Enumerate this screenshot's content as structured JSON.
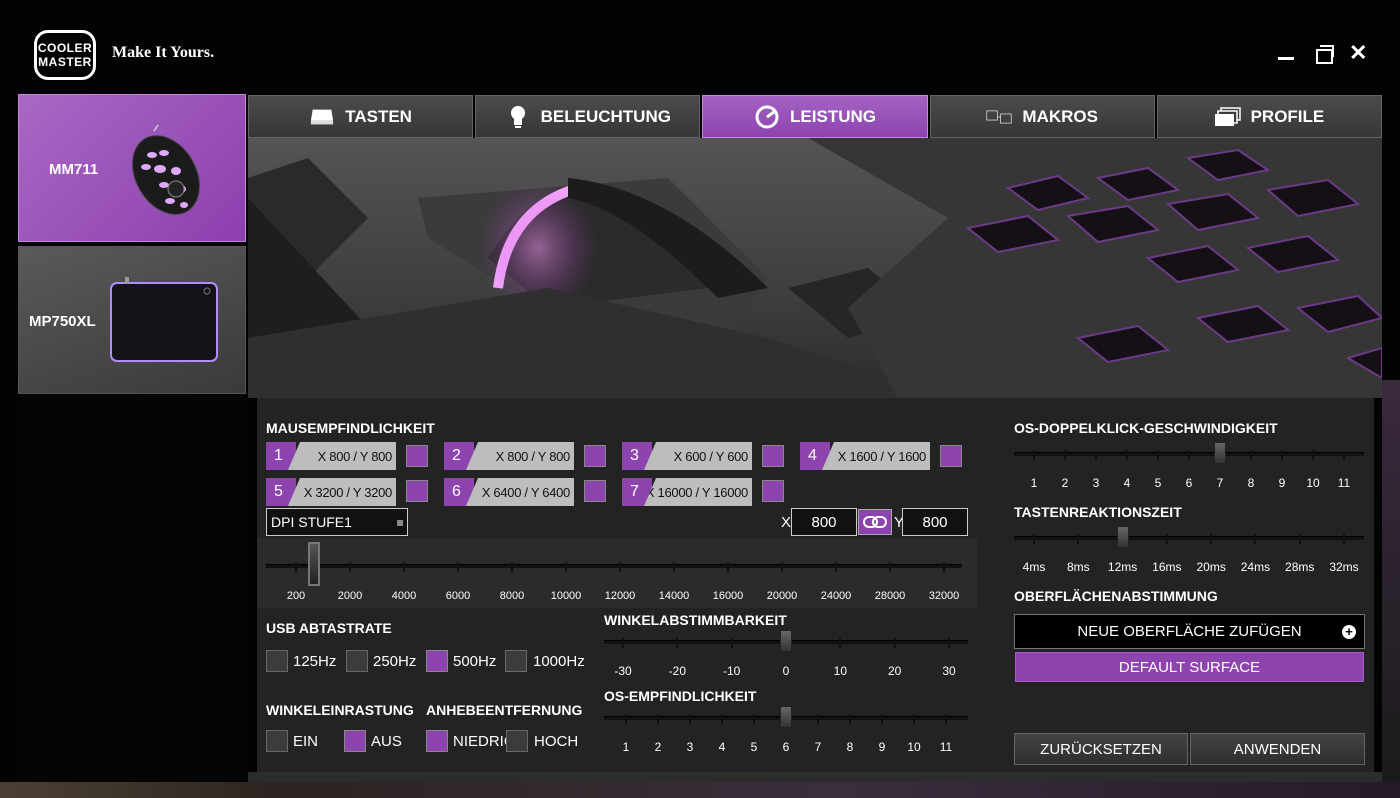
{
  "brand": {
    "logo_line1": "COOLER",
    "logo_line2": "MASTER",
    "tagline": "Make It Yours."
  },
  "window_controls": {
    "close": "✕"
  },
  "devices": [
    {
      "name": "MM711"
    },
    {
      "name": "MP750XL"
    }
  ],
  "tabs": [
    {
      "label": "TASTEN"
    },
    {
      "label": "BELEUCHTUNG"
    },
    {
      "label": "LEISTUNG",
      "active": true
    },
    {
      "label": "MAKROS"
    },
    {
      "label": "PROFILE"
    }
  ],
  "sensitivity": {
    "title": "MAUSEMPFINDLICHKEIT",
    "stages": [
      {
        "num": "1",
        "value": "X 800 / Y 800",
        "enabled": true
      },
      {
        "num": "2",
        "value": "X 800 / Y 800",
        "enabled": true
      },
      {
        "num": "3",
        "value": "X 600 / Y 600",
        "enabled": true
      },
      {
        "num": "4",
        "value": "X 1600 / Y 1600",
        "enabled": true
      },
      {
        "num": "5",
        "value": "X 3200 / Y 3200",
        "enabled": true
      },
      {
        "num": "6",
        "value": "X 6400 / Y 6400",
        "enabled": true
      },
      {
        "num": "7",
        "value": "X 16000 / Y 16000",
        "enabled": true
      }
    ],
    "stage_select": "DPI STUFE1",
    "x_label": "X",
    "x_value": "800",
    "y_label": "Y",
    "y_value": "800",
    "slider_ticks": [
      "200",
      "2000",
      "4000",
      "6000",
      "8000",
      "10000",
      "12000",
      "14000",
      "16000",
      "20000",
      "24000",
      "28000",
      "32000"
    ],
    "slider_value": 800
  },
  "polling": {
    "title": "USB ABTASTRATE",
    "options": [
      {
        "label": "125Hz",
        "checked": false
      },
      {
        "label": "250Hz",
        "checked": false
      },
      {
        "label": "500Hz",
        "checked": true
      },
      {
        "label": "1000Hz",
        "checked": false
      }
    ]
  },
  "angle_snapping": {
    "title": "WINKELEINRASTUNG",
    "options": [
      {
        "label": "EIN",
        "checked": false
      },
      {
        "label": "AUS",
        "checked": true
      }
    ]
  },
  "lift_off": {
    "title": "ANHEBEENTFERNUNG",
    "options": [
      {
        "label": "NIEDRIG",
        "checked": true
      },
      {
        "label": "HOCH",
        "checked": false
      }
    ]
  },
  "angle_tuning": {
    "title": "WINKELABSTIMMBARKEIT",
    "ticks": [
      "-30",
      "-20",
      "-10",
      "0",
      "10",
      "20",
      "30"
    ],
    "value": 0
  },
  "os_sensitivity": {
    "title": "OS-EMPFINDLICHKEIT",
    "ticks": [
      "1",
      "2",
      "3",
      "4",
      "5",
      "6",
      "7",
      "8",
      "9",
      "10",
      "11"
    ],
    "value": 6
  },
  "double_click": {
    "title": "OS-DOPPELKLICK-GESCHWINDIGKEIT",
    "ticks": [
      "1",
      "2",
      "3",
      "4",
      "5",
      "6",
      "7",
      "8",
      "9",
      "10",
      "11"
    ],
    "value": 7
  },
  "response_time": {
    "title": "TASTENREAKTIONSZEIT",
    "ticks": [
      "4ms",
      "8ms",
      "12ms",
      "16ms",
      "20ms",
      "24ms",
      "28ms",
      "32ms"
    ],
    "value_index": 2
  },
  "surface": {
    "title": "OBERFLÄCHENABSTIMMUNG",
    "add_label": "NEUE OBERFLÄCHE ZUFÜGEN",
    "default_label": "DEFAULT SURFACE"
  },
  "actions": {
    "reset": "ZURÜCKSETZEN",
    "apply": "ANWENDEN"
  },
  "colors": {
    "accent": "#8e44ae",
    "panel": "#242424"
  }
}
